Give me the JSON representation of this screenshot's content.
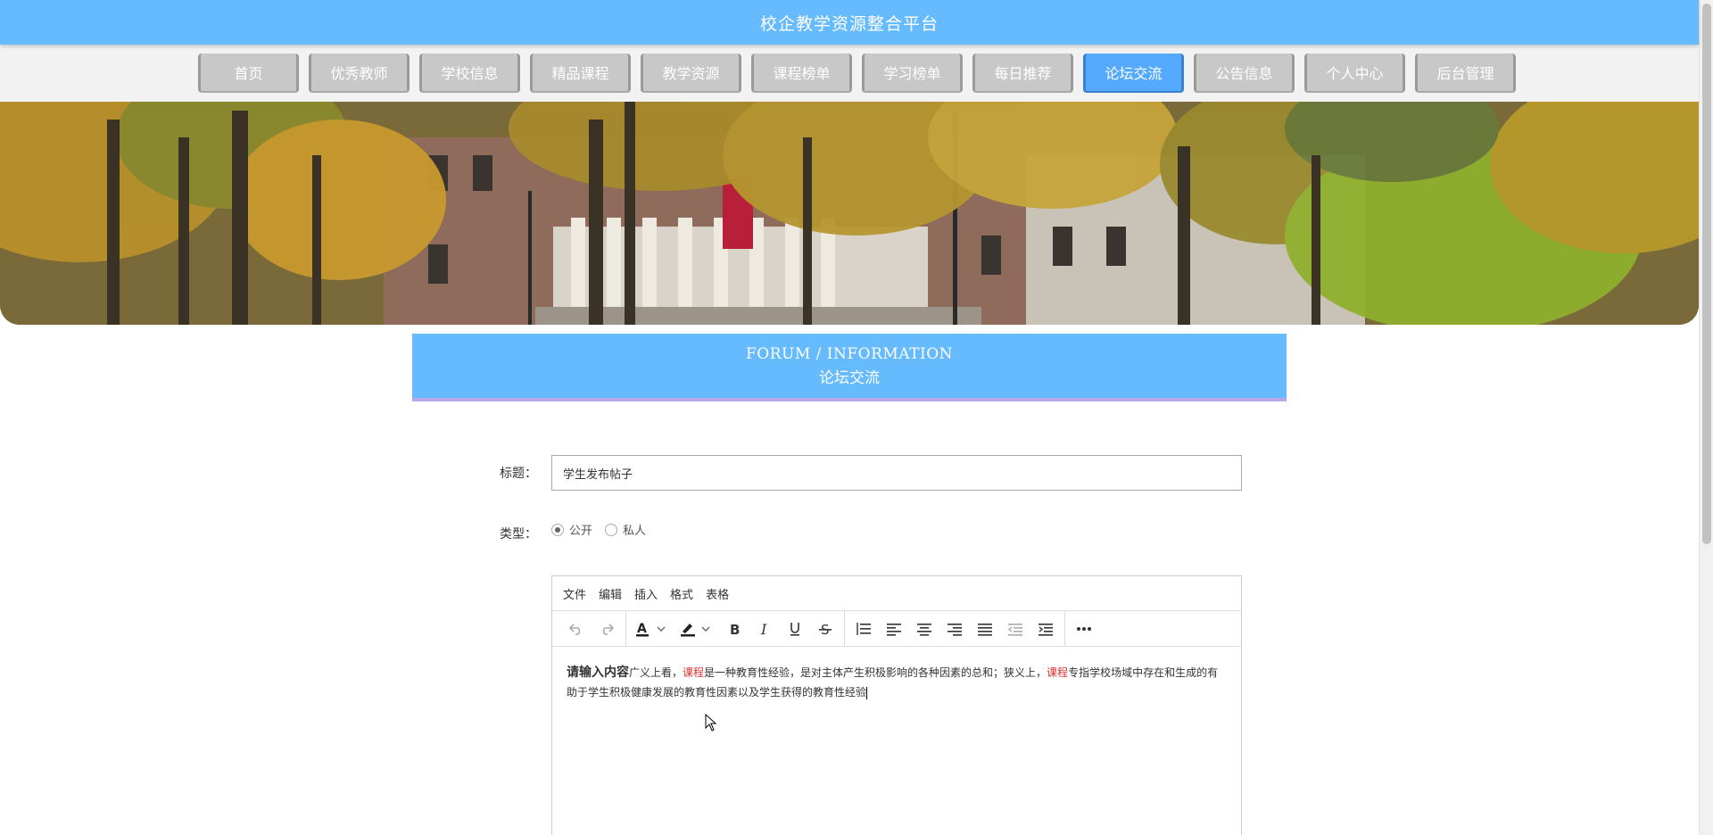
{
  "header": {
    "title": "校企教学资源整合平台"
  },
  "nav": {
    "items": [
      {
        "label": "首页"
      },
      {
        "label": "优秀教师"
      },
      {
        "label": "学校信息"
      },
      {
        "label": "精品课程"
      },
      {
        "label": "教学资源"
      },
      {
        "label": "课程榜单"
      },
      {
        "label": "学习榜单"
      },
      {
        "label": "每日推荐"
      },
      {
        "label": "论坛交流",
        "active": true
      },
      {
        "label": "公告信息"
      },
      {
        "label": "个人中心"
      },
      {
        "label": "后台管理"
      }
    ]
  },
  "section": {
    "title_en": "FORUM / INFORMATION",
    "title_cn": "论坛交流"
  },
  "form": {
    "title_label": "标题：",
    "title_value": "学生发布帖子",
    "type_label": "类型：",
    "type_options": [
      {
        "label": "公开",
        "checked": true
      },
      {
        "label": "私人",
        "checked": false
      }
    ]
  },
  "editor": {
    "menu": [
      "文件",
      "编辑",
      "插入",
      "格式",
      "表格"
    ],
    "toolbar_icons": [
      "undo-icon",
      "redo-icon",
      "text-color-icon",
      "highlight-color-icon",
      "bold-icon",
      "italic-icon",
      "underline-icon",
      "strikethrough-icon",
      "line-height-icon",
      "align-left-icon",
      "align-center-icon",
      "align-right-icon",
      "justify-icon",
      "outdent-icon",
      "indent-icon",
      "more-icon"
    ],
    "content": {
      "lead": "请输入内容",
      "part1": "广义上看，",
      "red1": "课程",
      "part2": "是一种教育性经验，是对主体产生积极影响的各种因素的总和；狭义上，",
      "red2": "课程",
      "part3": "专指学校场域中存在和生成的有助于学生积极健康发展的教育性因素以及学生获得的教育性经验"
    }
  },
  "colors": {
    "primary": "#66bbff",
    "nav_inactive": "#c8c8c8",
    "nav_active": "#55aaff",
    "accent_red": "#e03030",
    "underline_purple": "#b8a8e8"
  }
}
